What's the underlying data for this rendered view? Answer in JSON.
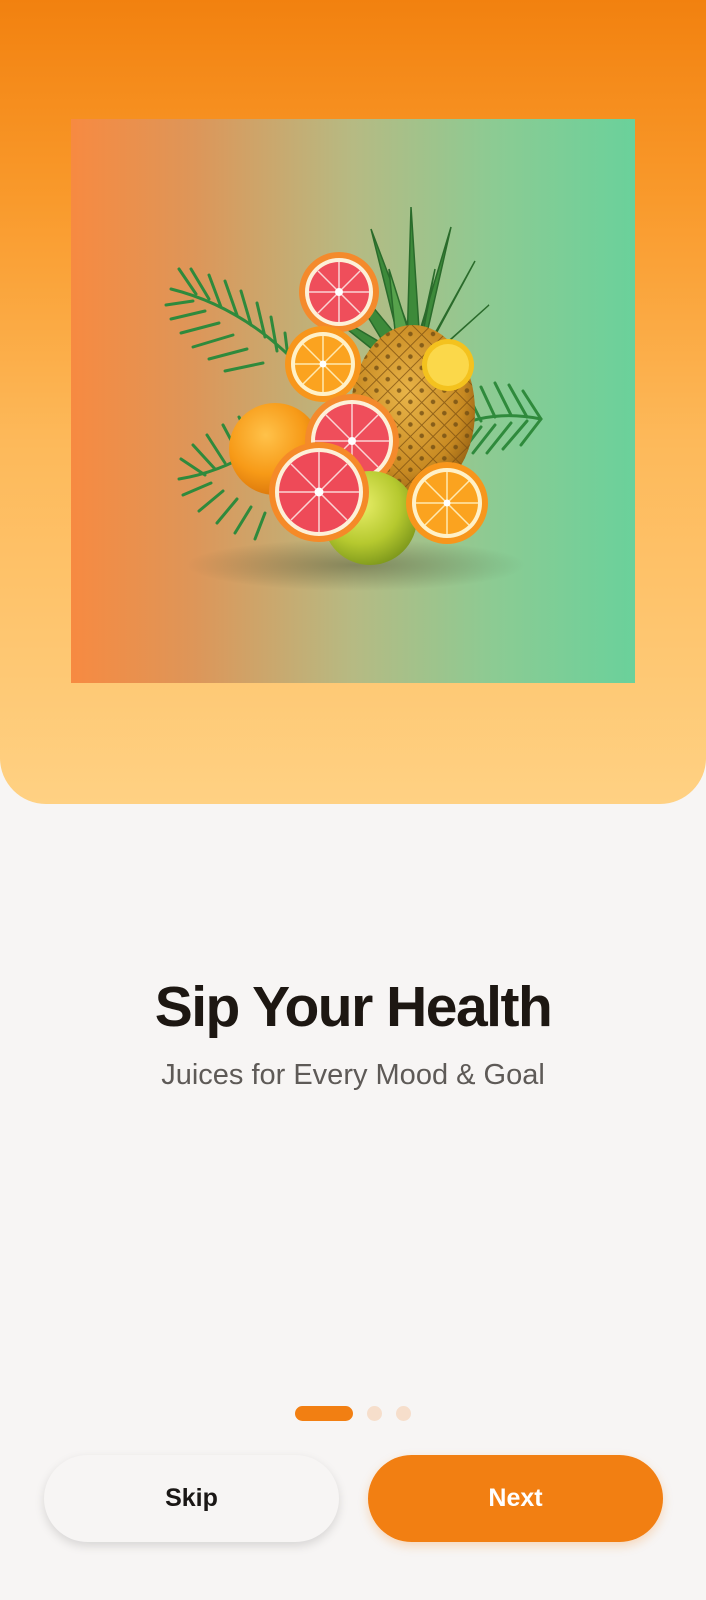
{
  "hero": {
    "image": "tropical-fruits-illustration"
  },
  "onboarding": {
    "title": "Sip Your Health",
    "subtitle": "Juices for Every Mood & Goal"
  },
  "pagination": {
    "current_page": 1,
    "total_pages": 3
  },
  "actions": {
    "skip_label": "Skip",
    "next_label": "Next"
  },
  "colors": {
    "accent": "#f27f12",
    "background": "#f7f5f4",
    "inactive_dot": "#f6decb"
  }
}
